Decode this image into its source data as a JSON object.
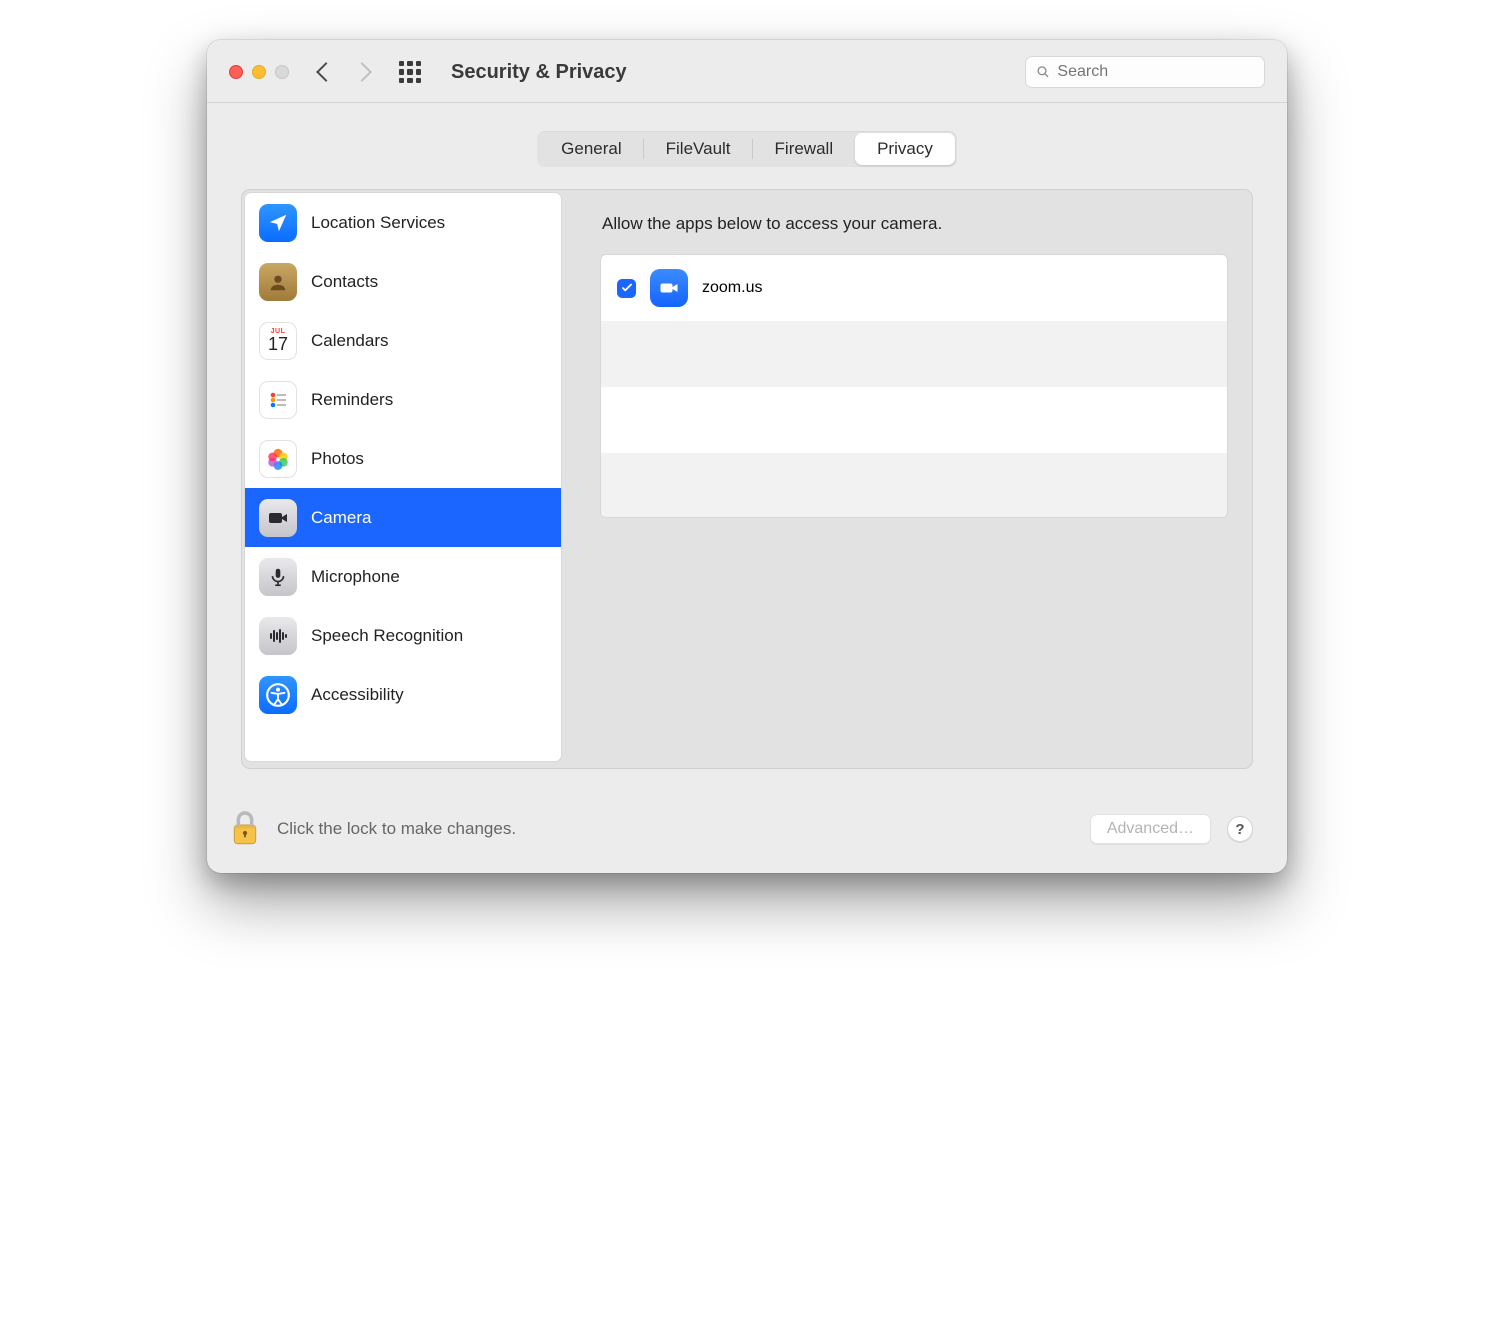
{
  "title": "Security & Privacy",
  "search": {
    "placeholder": "Search"
  },
  "tabs": [
    {
      "label": "General",
      "active": false
    },
    {
      "label": "FileVault",
      "active": false
    },
    {
      "label": "Firewall",
      "active": false
    },
    {
      "label": "Privacy",
      "active": true
    }
  ],
  "sidebar": {
    "items": [
      {
        "label": "Location Services",
        "icon": "location"
      },
      {
        "label": "Contacts",
        "icon": "contacts"
      },
      {
        "label": "Calendars",
        "icon": "calendar",
        "badge": "JUL",
        "day": "17"
      },
      {
        "label": "Reminders",
        "icon": "reminders"
      },
      {
        "label": "Photos",
        "icon": "photos"
      },
      {
        "label": "Camera",
        "icon": "camera",
        "selected": true
      },
      {
        "label": "Microphone",
        "icon": "microphone"
      },
      {
        "label": "Speech Recognition",
        "icon": "speech"
      },
      {
        "label": "Accessibility",
        "icon": "accessibility"
      }
    ]
  },
  "content": {
    "heading": "Allow the apps below to access your camera.",
    "apps": [
      {
        "name": "zoom.us",
        "checked": true
      }
    ]
  },
  "footer": {
    "lock_label": "Click the lock to make changes.",
    "advanced_label": "Advanced…",
    "help_label": "?"
  }
}
